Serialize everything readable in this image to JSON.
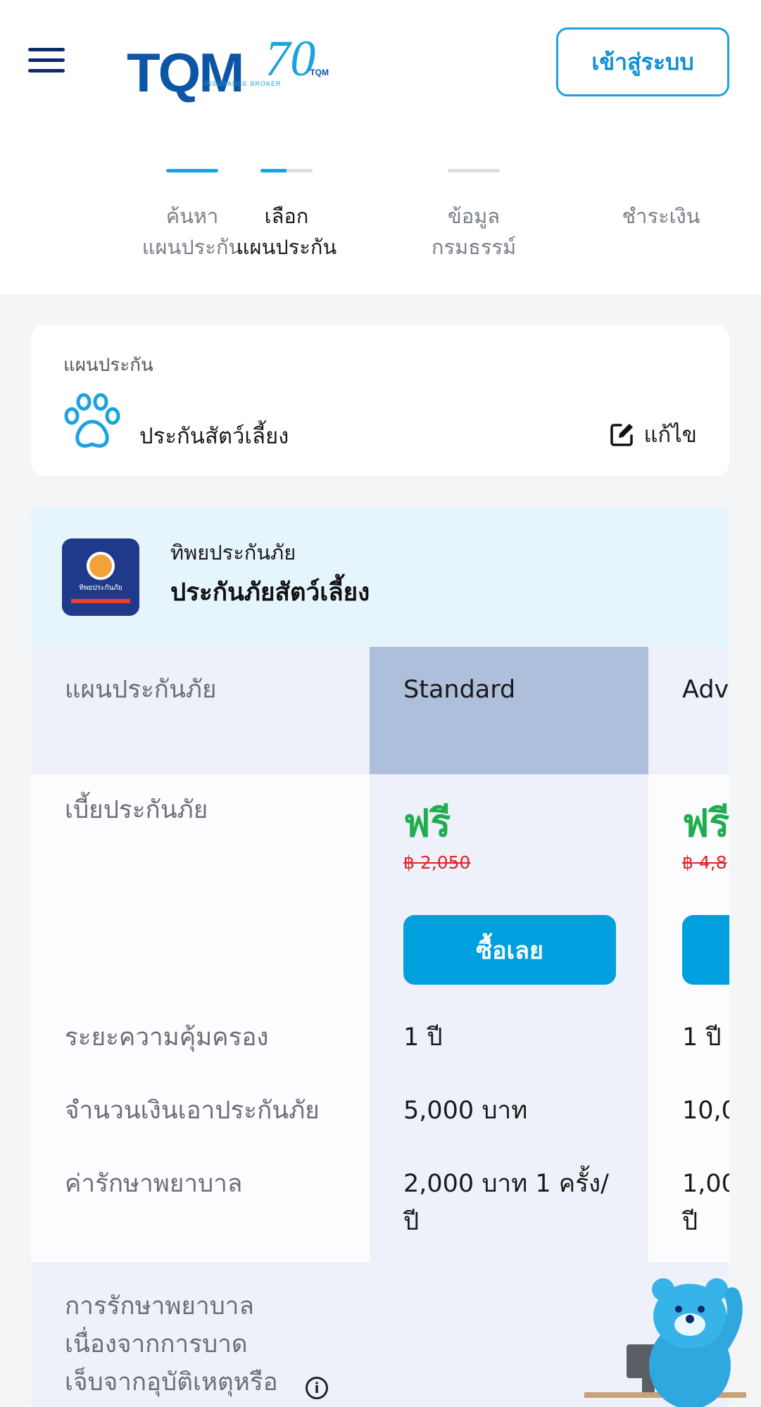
{
  "header": {
    "logo_text": "TQM",
    "logo_sub": "INSURANCE BROKER",
    "anniversary": "70",
    "anniversary_mark": "TQM",
    "login_label": "เข้าสู่ระบบ"
  },
  "steps": [
    {
      "label": "ค้นหา\nแผนประกัน",
      "progress": 1.0
    },
    {
      "label": "เลือก\nแผนประกัน",
      "progress": 0.5
    },
    {
      "label": "ข้อมูล\nกรมธรรม์",
      "progress": 0.0
    },
    {
      "label": "ชำระเงิน",
      "progress": 0.0
    }
  ],
  "plan": {
    "caption": "แผนประกัน",
    "name": "ประกันสัตว์เลี้ยง",
    "edit_label": "แก้ไข"
  },
  "product": {
    "company": "ทิพยประกันภัย",
    "name": "ประกันภัยสัตว์เลี้ยง",
    "logo_text": "ทิพยประกันภัย"
  },
  "table": {
    "header_label": "แผนประกันภัย",
    "plans": [
      "Standard",
      "Adv"
    ],
    "premium_label": "เบี้ยประกันภัย",
    "free_label": "ฟรี",
    "prices": [
      "฿ 2,050",
      "฿ 4,8"
    ],
    "buy_label": "ซื้อเลย",
    "rows": [
      {
        "label": "ระยะความคุ้มครอง",
        "values": [
          "1 ปี",
          "1 ปี"
        ]
      },
      {
        "label": "จำนวนเงินเอาประกันภัย",
        "values": [
          "5,000 บาท",
          "10,0"
        ]
      },
      {
        "label": "ค่ารักษาพยาบาล",
        "values": [
          "2,000 บาท 1 ครั้ง/\nปี",
          "1,00\nปี"
        ]
      }
    ],
    "bottom_label": "การรักษาพยาบาล\nเนื่องจากการบาด\nเจ็บจากอุบัติเหตุหรือ"
  },
  "colors": {
    "accent": "#00a0df",
    "navy": "#0d2a6b",
    "free": "#1fae4f",
    "old_price": "#e02424",
    "selected_header": "#aebfdb"
  }
}
